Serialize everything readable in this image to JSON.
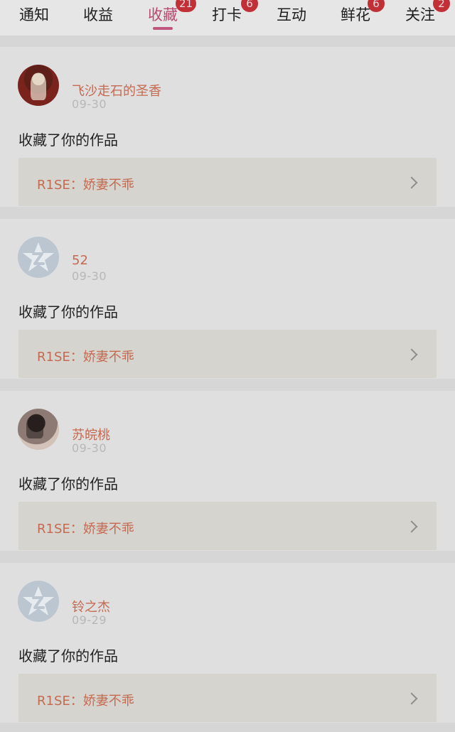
{
  "tabs": [
    {
      "label": "通知",
      "badge": ""
    },
    {
      "label": "收益",
      "badge": ""
    },
    {
      "label": "收藏",
      "badge": "21",
      "active": true
    },
    {
      "label": "打卡",
      "badge": "6"
    },
    {
      "label": "互动",
      "badge": ""
    },
    {
      "label": "鲜花",
      "badge": "6"
    },
    {
      "label": "关注",
      "badge": "2"
    }
  ],
  "feed": {
    "items": [
      {
        "username": "飞沙走石的圣香",
        "date": "09-30",
        "action": "收藏了你的作品",
        "work_title": "R1SE：娇妻不乖",
        "avatar": "photo-1"
      },
      {
        "username": "52",
        "date": "09-30",
        "action": "收藏了你的作品",
        "work_title": "R1SE：娇妻不乖",
        "avatar": "default"
      },
      {
        "username": "苏皖桃",
        "date": "09-30",
        "action": "收藏了你的作品",
        "work_title": "R1SE：娇妻不乖",
        "avatar": "photo-2"
      },
      {
        "username": "铃之杰",
        "date": "09-29",
        "action": "收藏了你的作品",
        "work_title": "R1SE：娇妻不乖",
        "avatar": "default"
      }
    ]
  },
  "colors": {
    "accent": "#c0567d",
    "badge": "#c13037",
    "name": "#c56a50"
  },
  "icons": {
    "default_avatar": "qq-star-avatar-icon",
    "chevron": "chevron-right-icon"
  }
}
